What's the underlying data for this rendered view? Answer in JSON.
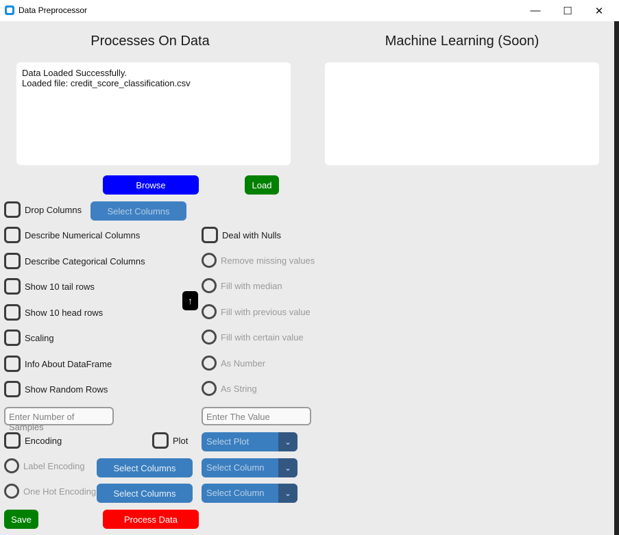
{
  "window": {
    "title": "Data Preprocessor",
    "minimize": "—",
    "maximize": "☐",
    "close": "✕"
  },
  "left_panel": {
    "heading": "Processes On Data",
    "log_lines": [
      "Data Loaded Successfully.",
      "Loaded file: credit_score_classification.csv"
    ]
  },
  "right_panel": {
    "heading": "Machine Learning (Soon)"
  },
  "buttons": {
    "browse": "Browse",
    "load": "Load",
    "select_columns_drop": "Select Columns",
    "select_columns_label": "Select Columns",
    "select_columns_onehot": "Select Columns",
    "save": "Save",
    "process": "Process Data",
    "scroll_top": "↑"
  },
  "checkboxes": {
    "drop_columns": "Drop Columns",
    "describe_numerical": "Describe Numerical Columns",
    "describe_categorical": "Describe Categorical Columns",
    "tail_rows": "Show 10 tail rows",
    "head_rows": "Show 10 head rows",
    "scaling": "Scaling",
    "info": "Info About DataFrame",
    "random_rows": "Show Random Rows",
    "deal_nulls": "Deal with Nulls",
    "encoding": "Encoding",
    "plot": "Plot"
  },
  "radios": {
    "remove_missing": "Remove missing values",
    "fill_median": "Fill with median",
    "fill_previous": "Fill with previous value",
    "fill_certain": "Fill with certain value",
    "as_number": "As Number",
    "as_string": "As String",
    "label_encoding": "Label Encoding",
    "one_hot": "One Hot Encoding"
  },
  "inputs": {
    "samples_placeholder": "Enter Number of Samples",
    "value_placeholder": "Enter The Value"
  },
  "dropdowns": {
    "plot": "Select Plot",
    "column1": "Select Column",
    "column2": "Select Column",
    "arrow": "⌄"
  }
}
